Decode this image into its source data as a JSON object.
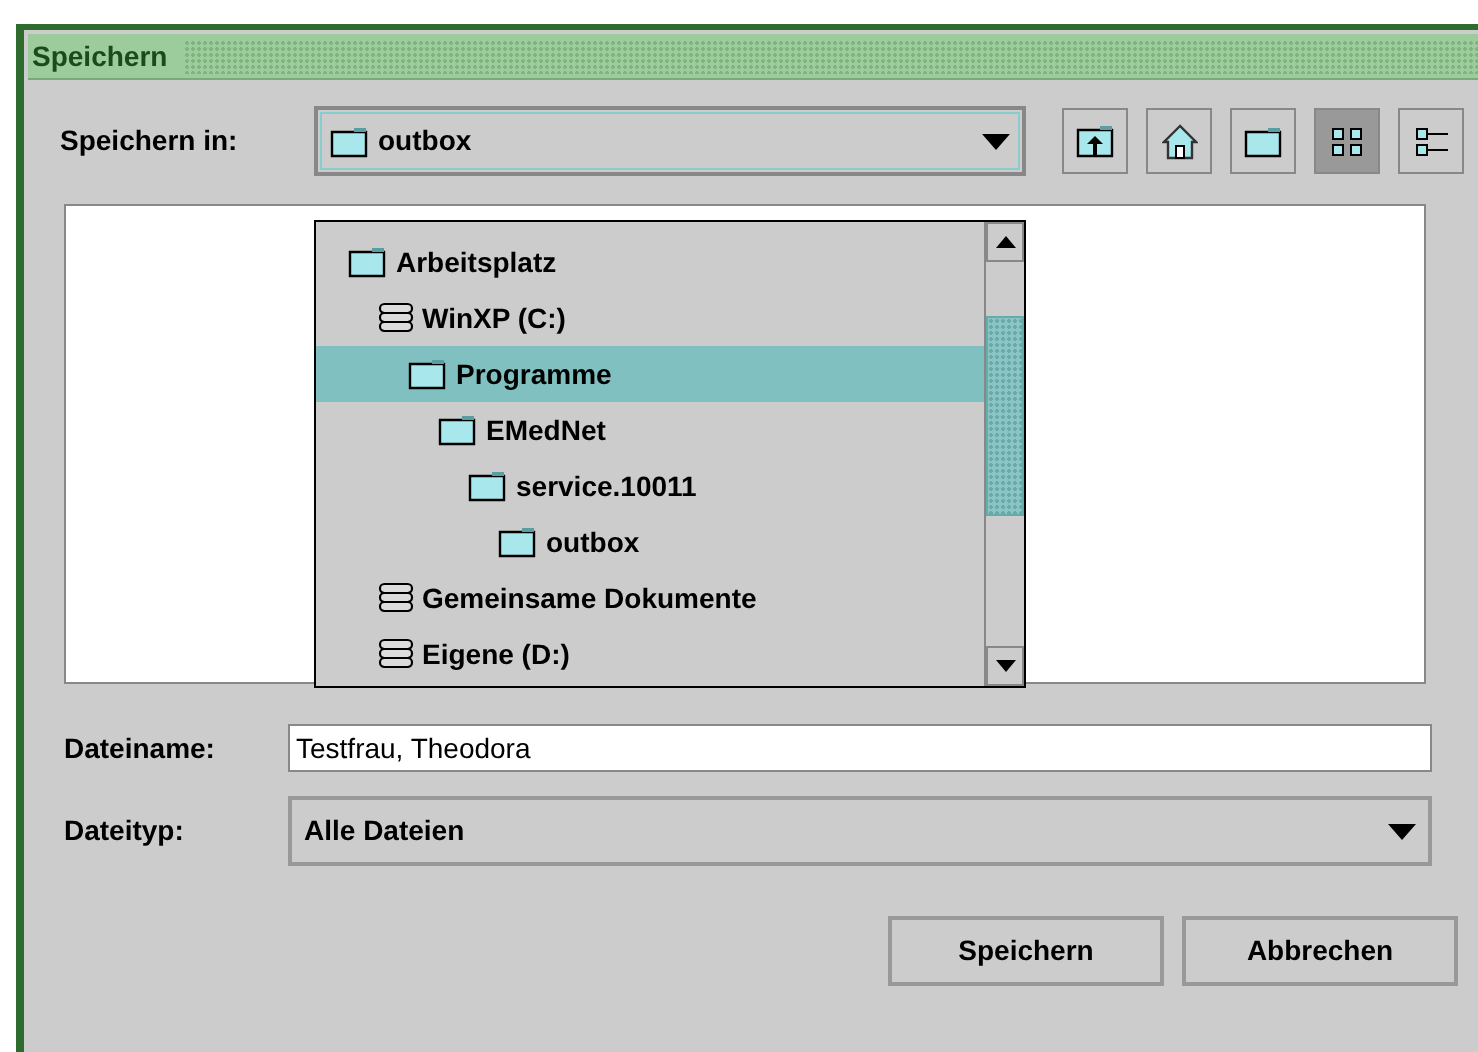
{
  "window": {
    "title": "Speichern"
  },
  "save_in": {
    "label": "Speichern in:",
    "value": "outbox"
  },
  "toolbar": [
    {
      "kind": "up",
      "selected": false
    },
    {
      "kind": "home",
      "selected": false
    },
    {
      "kind": "new-folder",
      "selected": false
    },
    {
      "kind": "list",
      "selected": true
    },
    {
      "kind": "details",
      "selected": false
    }
  ],
  "folder_tree": [
    {
      "kind": "folder",
      "label": "Arbeitsplatz",
      "selected": false,
      "children": [
        {
          "kind": "drive",
          "label": "WinXP (C:)",
          "selected": false,
          "children": [
            {
              "kind": "folder",
              "label": "Programme",
              "selected": true,
              "children": [
                {
                  "kind": "folder",
                  "label": "EMedNet",
                  "selected": false,
                  "children": [
                    {
                      "kind": "folder",
                      "label": "service.10011",
                      "selected": false,
                      "children": [
                        {
                          "kind": "folder",
                          "label": "outbox",
                          "selected": false
                        }
                      ]
                    }
                  ]
                }
              ]
            }
          ]
        },
        {
          "kind": "drive",
          "label": "Gemeinsame Dokumente",
          "selected": false
        },
        {
          "kind": "drive",
          "label": "Eigene (D:)",
          "selected": false
        }
      ]
    }
  ],
  "file_name": {
    "label": "Dateiname:",
    "value": "Testfrau, Theodora"
  },
  "file_type": {
    "label": "Dateityp:",
    "value": "Alle Dateien"
  },
  "buttons": [
    "Speichern",
    "Abbrechen"
  ]
}
